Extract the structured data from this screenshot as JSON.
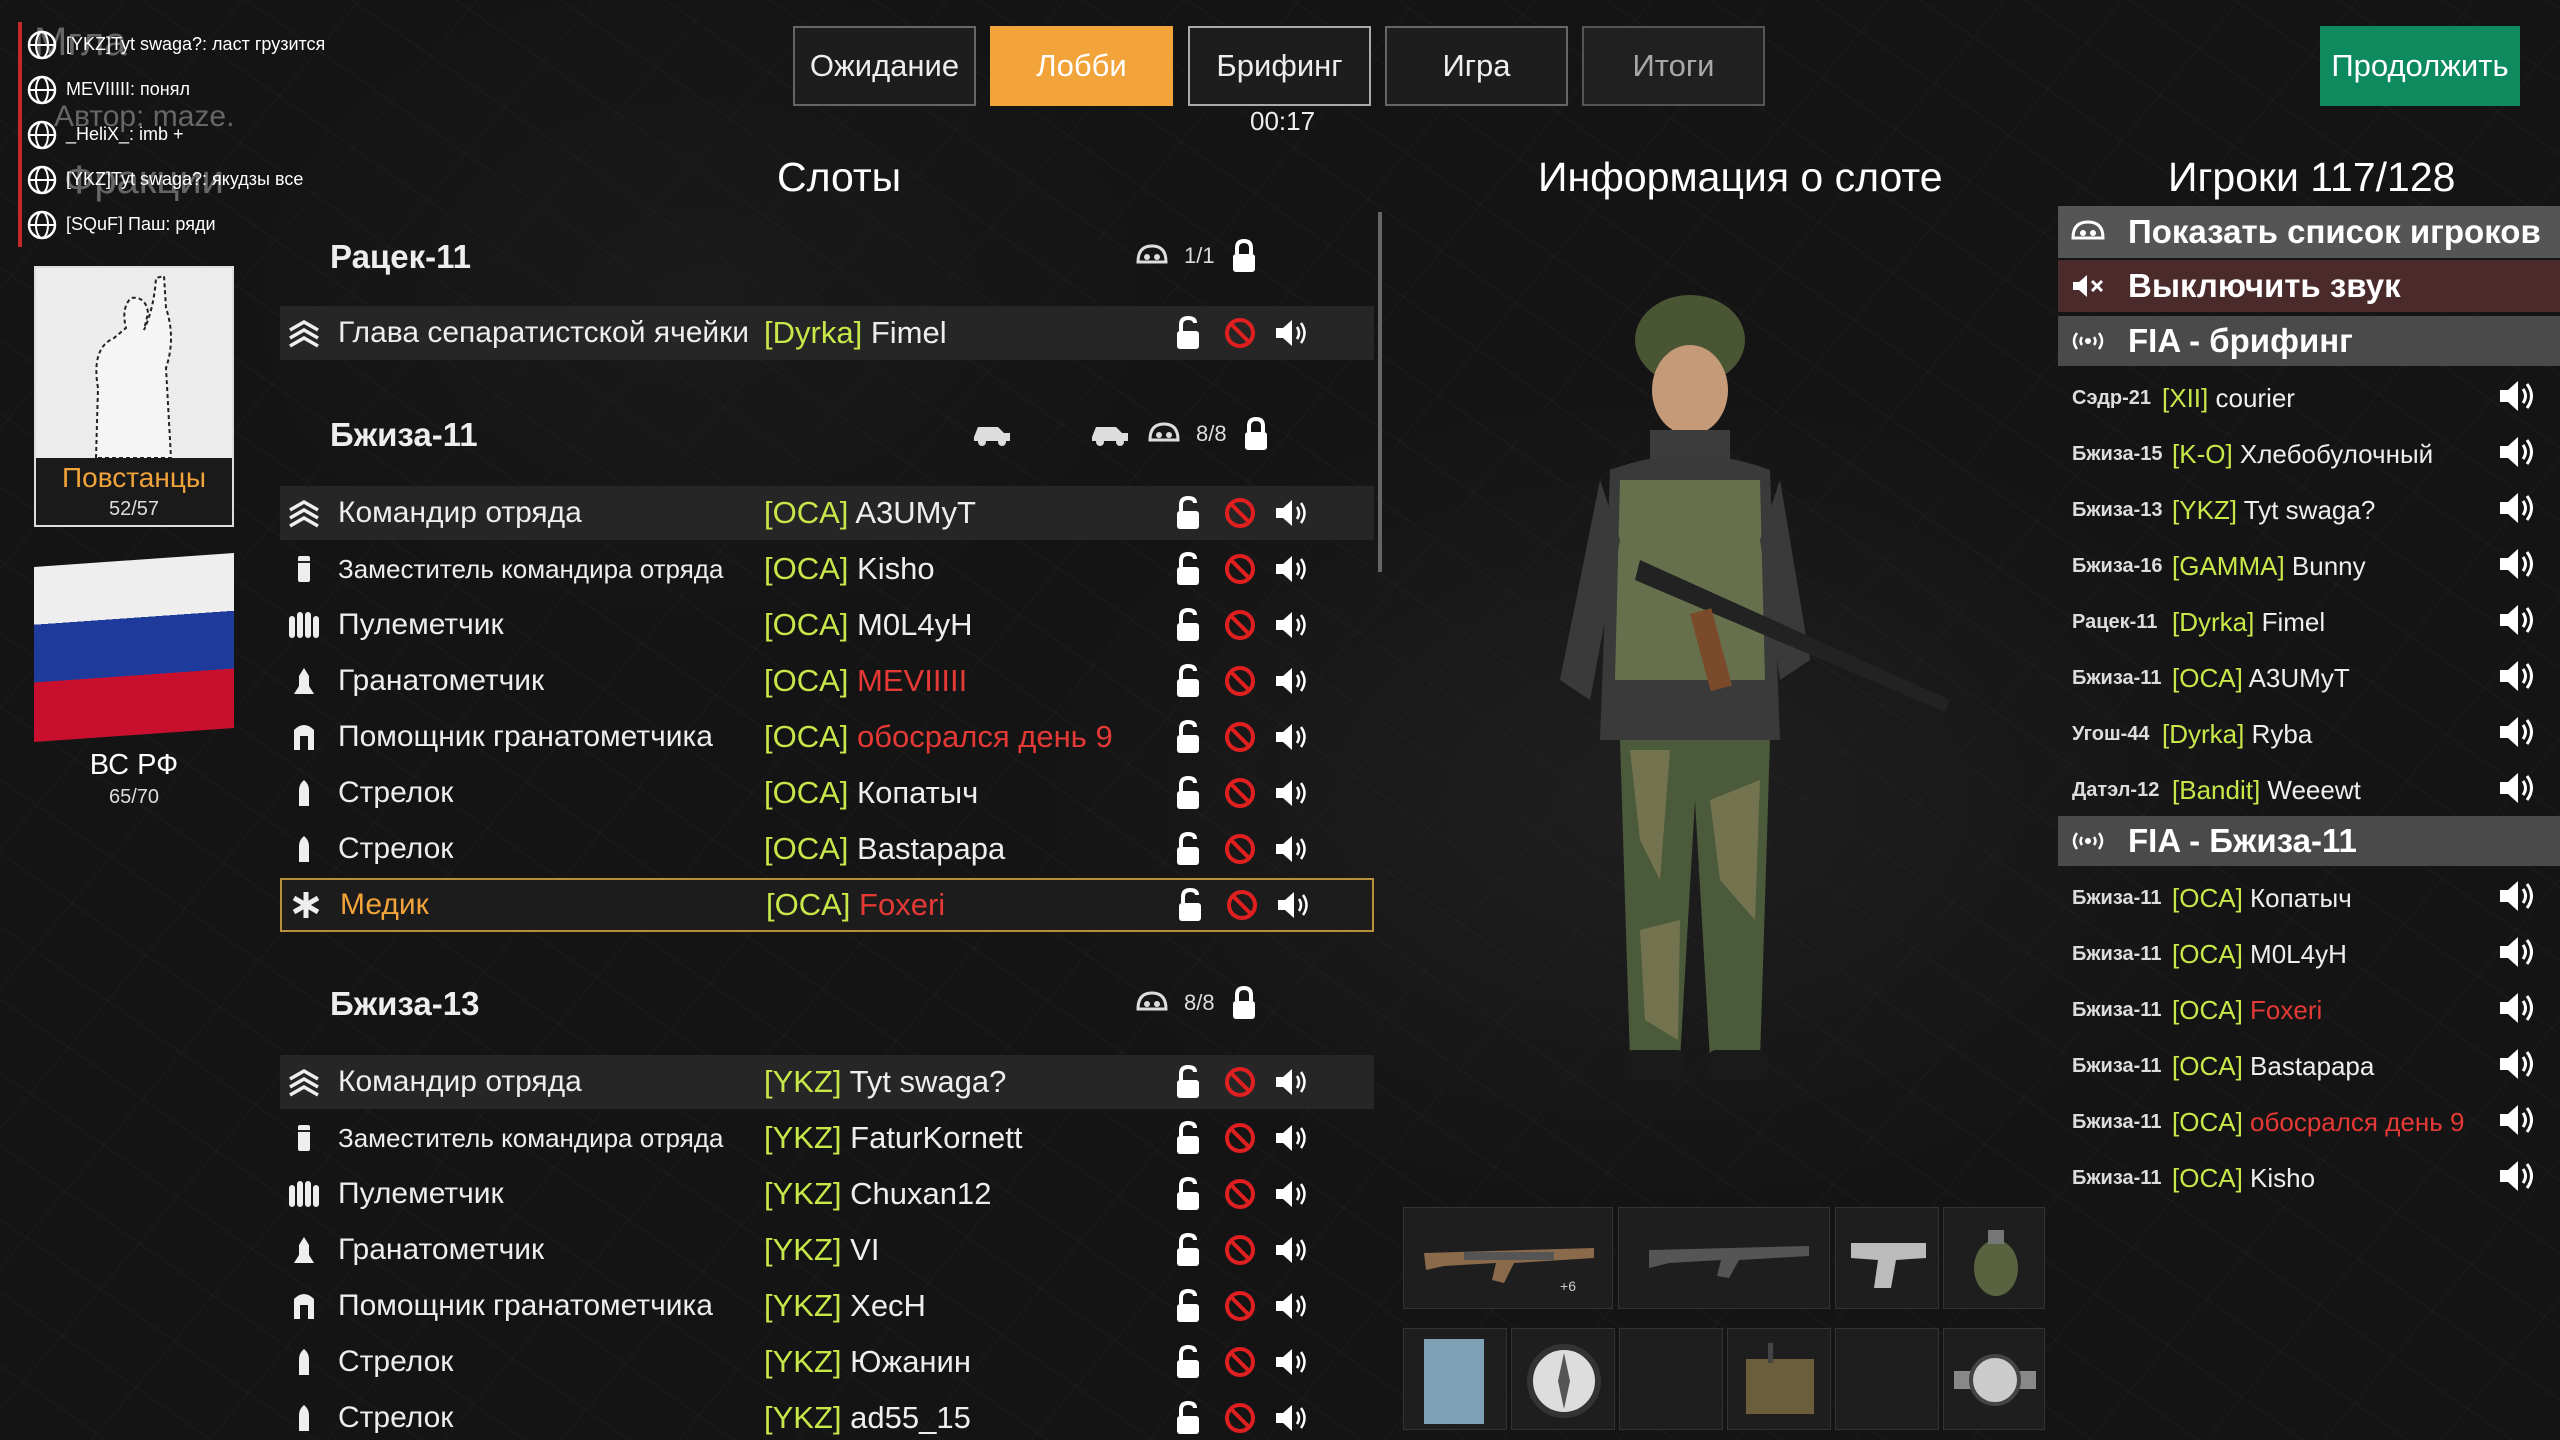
{
  "chat": [
    {
      "text": "[YKZ]Tyt swaga?: ласт грузится"
    },
    {
      "text": "MEVIIIII: понял"
    },
    {
      "text": "_HeliX_: imb +"
    },
    {
      "text": "[YKZ]Tyt swaga?: якудзы все"
    },
    {
      "text": "[SQuF] Паш: ряди"
    }
  ],
  "ghost": {
    "title": "Мгла",
    "author": "Автор: maze.",
    "section": "Фракции"
  },
  "tabs": [
    "Ожидание",
    "Лобби",
    "Брифинг",
    "Игра",
    "Итоги"
  ],
  "active_tab": "Лобби",
  "timer": "00:17",
  "continue_label": "Продолжить",
  "headers": {
    "slots": "Слоты",
    "slot_info": "Информация о слоте",
    "players": "Игроки 117/128"
  },
  "factions": [
    {
      "name": "Повстанцы",
      "count": "52/57"
    },
    {
      "name": "ВС РФ",
      "count": "65/70"
    }
  ],
  "squads": [
    {
      "name": "Рацек-11",
      "count": "1/1",
      "slots": [
        {
          "role": "Глава сепаратистской ячейки",
          "tag": "[Dyrka]",
          "player": "Fimel",
          "red": false
        }
      ]
    },
    {
      "name": "Бжиза-11",
      "count": "8/8",
      "slots": [
        {
          "role": "Командир отряда",
          "tag": "[OCA]",
          "player": "A3UMyT",
          "red": false
        },
        {
          "role": "Заместитель командира отряда",
          "tag": "[OCA]",
          "player": "Kisho",
          "red": false
        },
        {
          "role": "Пулеметчик",
          "tag": "[OCA]",
          "player": "M0L4yH",
          "red": false
        },
        {
          "role": "Гранатометчик",
          "tag": "[OCA]",
          "player": "MEVIIIII",
          "red": "orange"
        },
        {
          "role": "Помощник гранатометчика",
          "tag": "[OCA]",
          "player": "обосрался день 9",
          "red": true
        },
        {
          "role": "Стрелок",
          "tag": "[OCA]",
          "player": "Копатыч",
          "red": false
        },
        {
          "role": "Стрелок",
          "tag": "[OCA]",
          "player": "Bastapapa",
          "red": false
        },
        {
          "role": "Медик",
          "tag": "[OCA]",
          "player": "Foxeri",
          "red": true
        }
      ]
    },
    {
      "name": "Бжиза-13",
      "count": "8/8",
      "slots": [
        {
          "role": "Командир отряда",
          "tag": "[YKZ]",
          "player": "Tyt swaga?",
          "red": false
        },
        {
          "role": "Заместитель командира отряда",
          "tag": "[YKZ]",
          "player": "FaturKornett",
          "red": false
        },
        {
          "role": "Пулеметчик",
          "tag": "[YKZ]",
          "player": "Chuxan12",
          "red": false
        },
        {
          "role": "Гранатометчик",
          "tag": "[YKZ]",
          "player": "VI",
          "red": false
        },
        {
          "role": "Помощник гранатометчика",
          "tag": "[YKZ]",
          "player": "XecH",
          "red": false
        },
        {
          "role": "Стрелок",
          "tag": "[YKZ]",
          "player": "Южанин",
          "red": false
        },
        {
          "role": "Стрелок",
          "tag": "[YKZ]",
          "player": "ad55_15",
          "red": false
        }
      ]
    }
  ],
  "loadout": {
    "primary_badge": "+6"
  },
  "player_list": {
    "show_list": "Показать список игроков",
    "mute": "Выключить звук",
    "groups": [
      {
        "name": "FIA - брифинг",
        "players": [
          {
            "squad": "Сэдр-21",
            "tag": "[XII]",
            "name": "courier",
            "red": false
          },
          {
            "squad": "Бжиза-15",
            "tag": "[K-O]",
            "name": "Хлебобулочный",
            "red": false
          },
          {
            "squad": "Бжиза-13",
            "tag": "[YKZ]",
            "name": "Tyt swaga?",
            "red": false
          },
          {
            "squad": "Бжиза-16",
            "tag": "[GAMMA]",
            "name": "Bunny",
            "red": false
          },
          {
            "squad": "Рацек-11",
            "tag": "[Dyrka]",
            "name": "Fimel",
            "red": false
          },
          {
            "squad": "Бжиза-11",
            "tag": "[OCA]",
            "name": "A3UMyT",
            "red": false
          },
          {
            "squad": "Угош-44",
            "tag": "[Dyrka]",
            "name": "Ryba",
            "red": false
          },
          {
            "squad": "Датэл-12",
            "tag": "[Bandit]",
            "name": "Weeewt",
            "red": false
          }
        ]
      },
      {
        "name": "FIA - Бжиза-11",
        "players": [
          {
            "squad": "Бжиза-11",
            "tag": "[OCA]",
            "name": "Копатыч",
            "red": false
          },
          {
            "squad": "Бжиза-11",
            "tag": "[OCA]",
            "name": "M0L4yH",
            "red": false
          },
          {
            "squad": "Бжиза-11",
            "tag": "[OCA]",
            "name": "Foxeri",
            "red": true
          },
          {
            "squad": "Бжиза-11",
            "tag": "[OCA]",
            "name": "Bastapapa",
            "red": false
          },
          {
            "squad": "Бжиза-11",
            "tag": "[OCA]",
            "name": "обосрался день 9",
            "red": true
          },
          {
            "squad": "Бжиза-11",
            "tag": "[OCA]",
            "name": "Kisho",
            "red": false
          }
        ]
      }
    ]
  },
  "colors": {
    "accent": "#f2a33a",
    "continue": "#0e8a5f",
    "tag": "#c8e84a",
    "red": "#e53935",
    "highlight_border": "#b8903c"
  }
}
